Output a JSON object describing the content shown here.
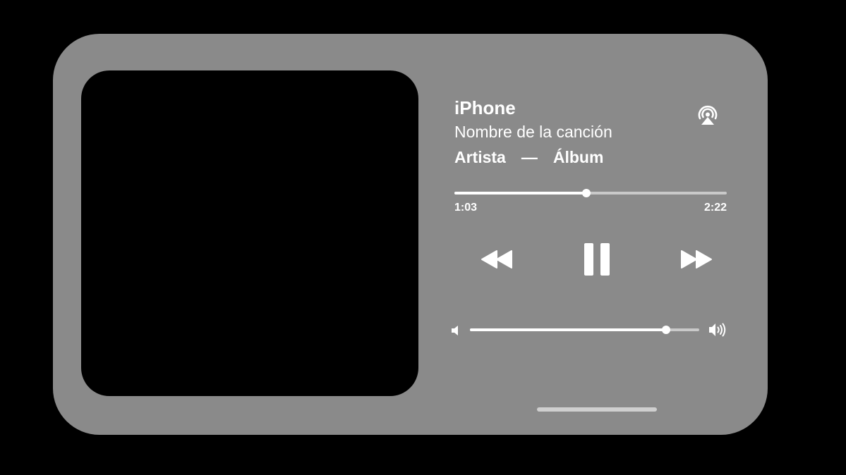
{
  "player": {
    "device_name": "iPhone",
    "song_title": "Nombre de la canción",
    "artist": "Artista",
    "separator": "—",
    "album": "Álbum",
    "elapsed": "1:03",
    "total": "2:22",
    "progress_fraction": 0.485,
    "volume_fraction": 0.855,
    "state": "playing"
  },
  "icons": {
    "airplay": "airplay-icon",
    "rewind": "rewind-icon",
    "pause": "pause-icon",
    "forward": "fast-forward-icon",
    "volume_low": "speaker-low-icon",
    "volume_high": "speaker-high-icon"
  },
  "colors": {
    "background": "#000000",
    "widget": "#8a8a8a",
    "artwork": "#000000",
    "foreground": "#ffffff",
    "track": "#c9c9c9"
  }
}
